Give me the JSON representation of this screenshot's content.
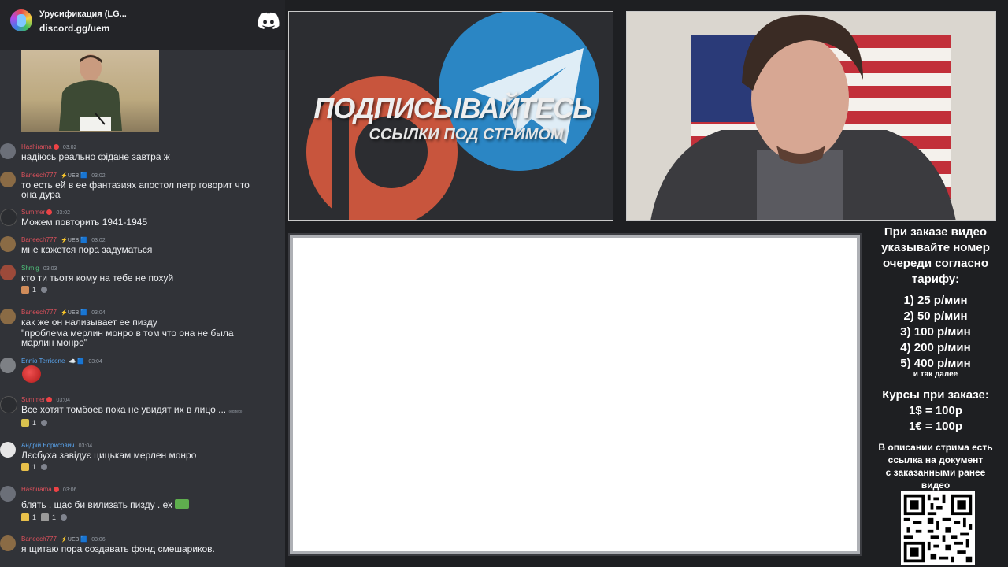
{
  "server": {
    "name": "Урусификация (LG...",
    "link": "discord.gg/uem"
  },
  "messages": [
    {
      "user": "Hashirama",
      "user_color": "#e0515c",
      "badges": "",
      "time": "03:02",
      "text": "надіюсь реально фідане завтра ж"
    },
    {
      "user": "Baneech777",
      "user_color": "#e0515c",
      "badges": "⚡UEB 🟦",
      "time": "03:02",
      "text_lines": [
        "то есть ей в ее фантазиях апостол петр говорит что",
        "она дура"
      ]
    },
    {
      "user": "Summer",
      "user_color": "#e0515c",
      "badges": "",
      "time": "03:02",
      "text": "Можем повторить 1941-1945"
    },
    {
      "user": "Baneech777",
      "user_color": "#e0515c",
      "badges": "⚡UEB 🟦",
      "time": "03:02",
      "text": "мне кажется пора задуматься"
    },
    {
      "user": "Shmig",
      "user_color": "#4fc47c",
      "badges": "",
      "time": "03:03",
      "text": "кто ти тьотя кому на тебе не похуй",
      "reaction_count": "1"
    },
    {
      "user": "Baneech777",
      "user_color": "#e0515c",
      "badges": "⚡UEB 🟦",
      "time": "03:04",
      "text_lines": [
        "как же он нализывает ее пизду",
        "\"проблема мерлин монро в том что она не была",
        "марлин монро\""
      ]
    },
    {
      "user": "Ennio Terricone",
      "user_color": "#5aa6f0",
      "badges": "☁️ 🟦",
      "time": "03:04",
      "text": ""
    },
    {
      "user": "Summer",
      "user_color": "#e0515c",
      "badges": "",
      "time": "03:04",
      "text": "Все хотят томбоев пока не увидят их в лицо ...",
      "edited": "(edited)",
      "reaction_count": "1"
    },
    {
      "user": "Андрій Борисович",
      "user_color": "#5aa6f0",
      "badges": "",
      "time": "03:04",
      "text": "Лєсбуха завідує цицькам мерлен  монро",
      "reaction_count": "1"
    },
    {
      "user": "Hashirama",
      "user_color": "#e0515c",
      "badges": "",
      "time": "03:06",
      "text": "блять . щас би вилизать пизду . ех",
      "reaction_count": "1",
      "reaction_count_2": "1"
    },
    {
      "user": "Baneech777",
      "user_color": "#e0515c",
      "badges": "⚡UEB 🟦",
      "time": "03:06",
      "text": "я щитаю пора создавать фонд смешариков."
    }
  ],
  "promo": {
    "title": "ПОДПИСЫВАЙТЕСЬ",
    "subtitle": "ССЫЛКИ ПОД СТРИМОМ"
  },
  "info": {
    "order_lines": [
      "При заказе видео",
      "указывайте номер",
      "очереди согласно",
      "тарифу:"
    ],
    "tariffs": [
      "1) 25 р/мин",
      "2) 50 р/мин",
      "3) 100 р/мин",
      "4) 200 р/мин",
      "5) 400 р/мин"
    ],
    "and_so_on": "и так далее",
    "rates_title": "Курсы при заказе:",
    "rates": [
      "1$ = 100р",
      "1€ = 100р"
    ],
    "desc_lines": [
      "В описании стрима есть",
      "ссылка на документ",
      "с заказанными ранее",
      "видео"
    ]
  },
  "colors": {
    "panel": "#313338",
    "header": "#232428",
    "patreon": "#c8553d",
    "telegram": "#2b86c4"
  }
}
